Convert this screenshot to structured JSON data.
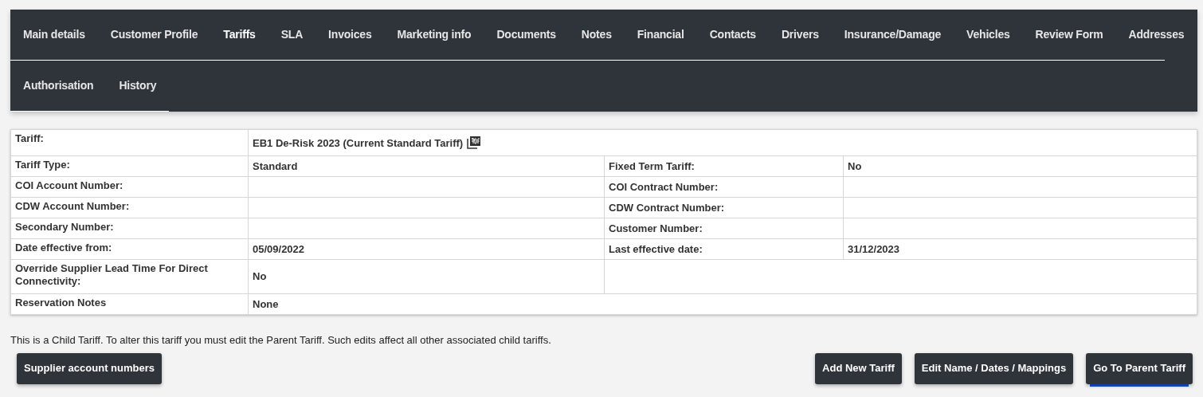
{
  "tabs": [
    {
      "label": "Main details",
      "selected": false
    },
    {
      "label": "Customer Profile",
      "selected": false
    },
    {
      "label": "Tariffs",
      "selected": true
    },
    {
      "label": "SLA",
      "selected": false
    },
    {
      "label": "Invoices",
      "selected": false
    },
    {
      "label": "Marketing info",
      "selected": false
    },
    {
      "label": "Documents",
      "selected": false
    },
    {
      "label": "Notes",
      "selected": false
    },
    {
      "label": "Financial",
      "selected": false
    },
    {
      "label": "Contacts",
      "selected": false
    },
    {
      "label": "Drivers",
      "selected": false
    },
    {
      "label": "Insurance/Damage",
      "selected": false
    },
    {
      "label": "Vehicles",
      "selected": false
    },
    {
      "label": "Review Form",
      "selected": false
    },
    {
      "label": "Addresses",
      "selected": false
    },
    {
      "label": "Authorisation",
      "selected": false
    },
    {
      "label": "History",
      "selected": false
    }
  ],
  "tariff_table": {
    "rows": [
      {
        "kind": "full",
        "label": "Tariff:",
        "value": "EB1 De-Risk 2023 (Current Standard Tariff)",
        "pdf_link": true
      },
      {
        "kind": "pair",
        "label": "Tariff Type:",
        "value": "Standard",
        "label_2": "Fixed Term Tariff:",
        "value_2": "No"
      },
      {
        "kind": "pair",
        "label": "COI Account Number:",
        "label_2": "COI Contract Number:"
      },
      {
        "kind": "pair",
        "label": "CDW Account Number:",
        "label_2": "CDW Contract Number:"
      },
      {
        "kind": "pair",
        "label": "Secondary Number:",
        "label_2": "Customer Number:"
      },
      {
        "kind": "pair",
        "label": "Date effective from:",
        "value": "05/09/2022",
        "label_2": "Last effective date:",
        "value_2": "31/12/2023"
      },
      {
        "kind": "half",
        "label": "Override Supplier Lead Time For Direct Connectivity:",
        "value": "No"
      },
      {
        "kind": "full",
        "label": "Reservation Notes",
        "value": "None"
      }
    ]
  },
  "notice": "This is a Child Tariff. To alter this tariff you must edit the Parent Tariff. Such edits affect all other associated child tariffs.",
  "left_buttons": [
    {
      "label": "Supplier account numbers",
      "focused": false
    }
  ],
  "right_buttons": [
    {
      "label": "Add New Tariff",
      "focused": false
    },
    {
      "label": "Edit Name / Dates / Mappings",
      "focused": false
    },
    {
      "label": "Go To Parent Tariff",
      "focused": true
    }
  ]
}
